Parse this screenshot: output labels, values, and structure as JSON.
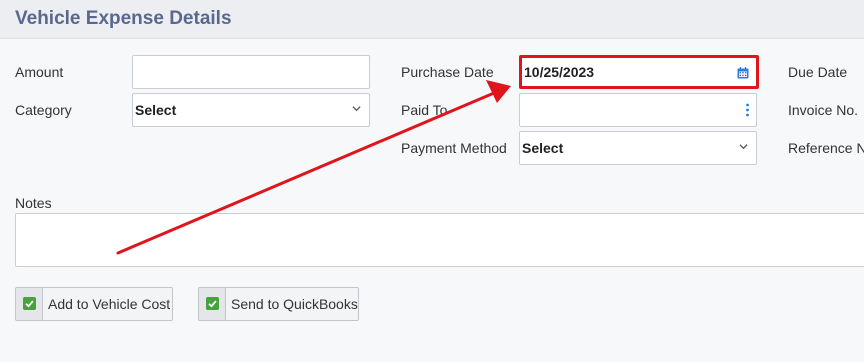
{
  "header": {
    "title": "Vehicle Expense Details"
  },
  "form": {
    "amount_label": "Amount",
    "amount_value": "",
    "category_label": "Category",
    "category_value": "Select",
    "purchase_date_label": "Purchase Date",
    "purchase_date_value": "10/25/2023",
    "paid_to_label": "Paid To",
    "paid_to_value": "",
    "payment_method_label": "Payment Method",
    "payment_method_value": "Select",
    "due_date_label": "Due Date",
    "invoice_label": "Invoice No.",
    "reference_label": "Reference N",
    "notes_label": "Notes",
    "notes_value": ""
  },
  "options": {
    "add_vehicle_cost_label": "Add to Vehicle Cost",
    "add_vehicle_cost_checked": true,
    "send_quickbooks_label": "Send to QuickBooks",
    "send_quickbooks_checked": true
  },
  "annotation": {
    "highlight_color": "#e0141b"
  },
  "colors": {
    "title": "#5a6890",
    "check": "#46a23a",
    "calendar_icon": "#2f7ae5"
  }
}
